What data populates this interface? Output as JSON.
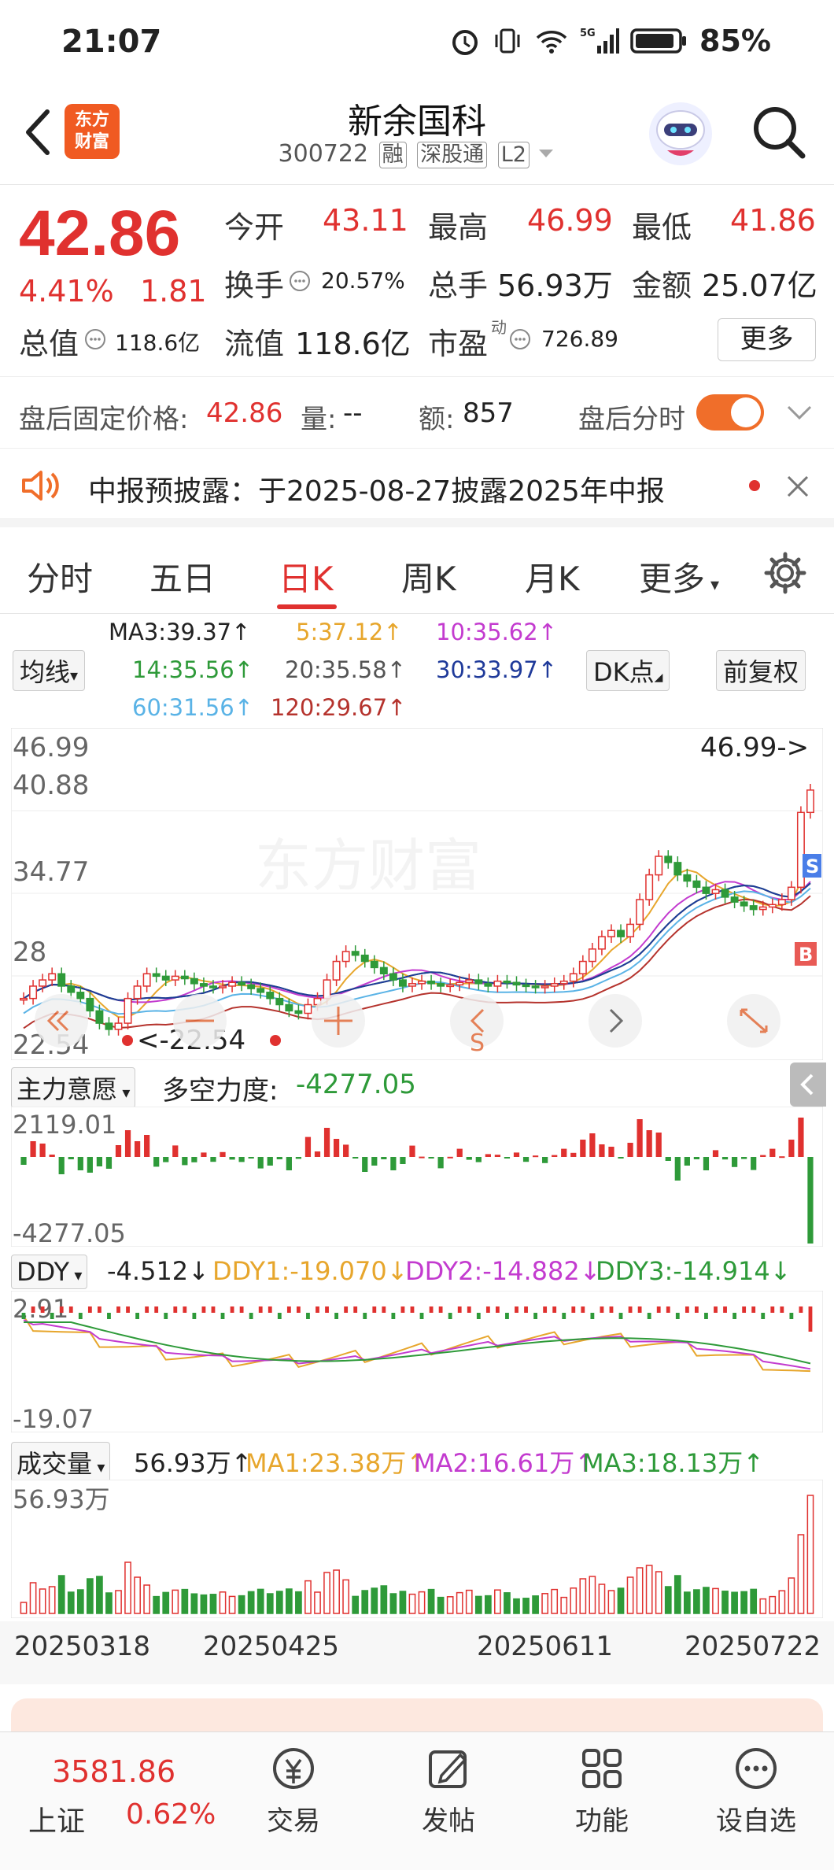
{
  "status_bar": {
    "time": "21:07",
    "battery": "85%",
    "signal": "5G"
  },
  "header": {
    "logo_text_1": "东方",
    "logo_text_2": "财富",
    "title": "新余国科",
    "code": "300722",
    "tag_rong": "融",
    "tag_sgt": "深股通",
    "tag_l2": "L2"
  },
  "quote": {
    "price": "42.86",
    "change_pct": "4.41%",
    "change_val": "1.81",
    "open_label": "今开",
    "open": "43.11",
    "high_label": "最高",
    "high": "46.99",
    "low_label": "最低",
    "low": "41.86",
    "turnover_label": "换手",
    "turnover": "20.57%",
    "volume_label": "总手",
    "volume": "56.93万",
    "amount_label": "金额",
    "amount": "25.07亿",
    "mktcap_label": "总值",
    "mktcap": "118.6亿",
    "float_label": "流值",
    "float": "118.6亿",
    "pe_label": "市盈",
    "pe_sup": "动",
    "pe": "726.89",
    "more": "更多"
  },
  "after_hours": {
    "fixed_price_label": "盘后固定价格:",
    "fixed_price": "42.86",
    "vol_label": "量:",
    "vol": "--",
    "amt_label": "额:",
    "amt": "857",
    "timeshare_label": "盘后分时"
  },
  "notice": {
    "text": "中报预披露：于2025-08-27披露2025年中报"
  },
  "tabs": [
    "分时",
    "五日",
    "日K",
    "周K",
    "月K",
    "更多"
  ],
  "ma_legend": {
    "selector": "均线",
    "ma3": "MA3:39.37↑",
    "ma5": "5:37.12↑",
    "ma10": "10:35.62↑",
    "ma14": "14:35.56↑",
    "ma20": "20:35.58↑",
    "ma30": "30:33.97↑",
    "ma60": "60:31.56↑",
    "ma120": "120:29.67↑",
    "dk_btn": "DK点",
    "fq_btn": "前复权"
  },
  "main_chart": {
    "y_top": "46.99",
    "y_mid1": "40.88",
    "y_mid2": "34.77",
    "y_low": "22.54",
    "y_partial": "28",
    "high_marker": "46.99->",
    "low_marker": "<-22.54",
    "watermark": "东方财富",
    "b_badge": "B",
    "s_badge": "S",
    "s_badge2": "S"
  },
  "indicator1": {
    "selector": "主力意愿",
    "label": "多空力度:",
    "value": "-4277.05",
    "ytop": "2119.01",
    "ybot": "-4277.05"
  },
  "indicator2": {
    "selector": "DDY",
    "v": "-4.512↓",
    "ddy1": "DDY1:-19.070↓",
    "ddy2": "DDY2:-14.882↓",
    "ddy3": "DDY3:-14.914↓",
    "ytop": "2.91",
    "ybot": "-19.07"
  },
  "indicator3": {
    "selector": "成交量",
    "v": "56.93万↑",
    "ma1": "MA1:23.38万↑",
    "ma2": "MA2:16.61万↑",
    "ma3": "MA3:18.13万↑",
    "ytop": "56.93万"
  },
  "dates": [
    "20250318",
    "20250425",
    "20250611",
    "20250722"
  ],
  "bottom_nav": {
    "index_value": "3581.86",
    "index_name": "上证",
    "index_change": "0.62%",
    "items": [
      "交易",
      "发帖",
      "功能",
      "设自选"
    ]
  },
  "chart_data": {
    "type": "candlestick",
    "price_range": [
      22.54,
      46.99
    ],
    "closes": [
      26,
      27,
      27.5,
      28,
      27,
      26.5,
      26,
      25,
      24,
      23.5,
      24,
      26,
      27,
      28,
      27.8,
      27.5,
      27.8,
      27.6,
      27.2,
      27,
      26.9,
      27,
      27.3,
      27.1,
      26.8,
      26.5,
      26,
      25.5,
      25,
      24.8,
      25.5,
      26,
      27.5,
      29,
      29.8,
      29.5,
      29,
      28.5,
      28,
      27.5,
      27,
      27.2,
      27.4,
      27.2,
      27,
      27.1,
      27.3,
      27.5,
      27.2,
      27,
      27.4,
      27.3,
      27.1,
      27,
      26.9,
      27,
      27.2,
      27.4,
      28,
      29,
      30,
      31,
      31.5,
      31,
      32,
      34,
      36,
      37.5,
      37,
      36,
      35.5,
      35,
      34.5,
      34.8,
      34.2,
      33.8,
      33.5,
      33.2,
      33.4,
      33.6,
      34,
      35,
      41.05,
      42.86
    ]
  }
}
